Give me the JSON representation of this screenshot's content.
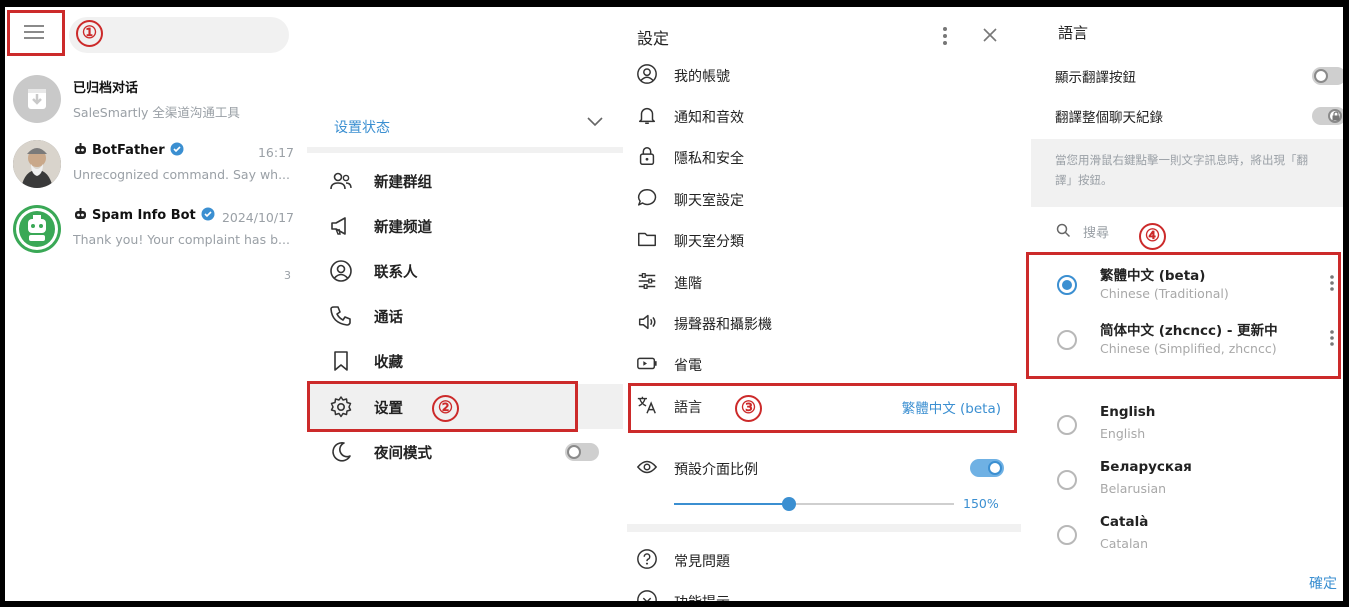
{
  "chat_list": {
    "search": {
      "placeholder": ""
    },
    "chats": [
      {
        "name": "已归档对话",
        "preview": "SaleSmartly 全渠道沟通工具",
        "time": ""
      },
      {
        "name": "BotFather",
        "preview": "Unrecognized command. Say wh...",
        "time": "16:17"
      },
      {
        "name": "Spam Info Bot",
        "preview": "Thank you! Your complaint has b...",
        "time": "2024/10/17"
      }
    ],
    "footer_mark": "3"
  },
  "main_menu": {
    "status_label": "设置状态",
    "items": [
      {
        "label": "新建群组",
        "icon": "group-icon"
      },
      {
        "label": "新建频道",
        "icon": "megaphone-icon"
      },
      {
        "label": "联系人",
        "icon": "contact-icon"
      },
      {
        "label": "通话",
        "icon": "phone-icon"
      },
      {
        "label": "收藏",
        "icon": "bookmark-icon"
      },
      {
        "label": "设置",
        "icon": "gear-icon"
      },
      {
        "label": "夜间模式",
        "icon": "moon-icon"
      }
    ],
    "night_mode": false
  },
  "settings": {
    "title": "設定",
    "items": [
      {
        "label": "我的帳號",
        "icon": "account-icon"
      },
      {
        "label": "通知和音效",
        "icon": "bell-icon"
      },
      {
        "label": "隱私和安全",
        "icon": "lock-icon"
      },
      {
        "label": "聊天室設定",
        "icon": "chat-bubble-icon"
      },
      {
        "label": "聊天室分類",
        "icon": "folder-icon"
      },
      {
        "label": "進階",
        "icon": "sliders-icon"
      },
      {
        "label": "揚聲器和攝影機",
        "icon": "speaker-icon"
      },
      {
        "label": "省電",
        "icon": "battery-icon"
      },
      {
        "label": "語言",
        "icon": "translate-icon",
        "value": "繁體中文 (beta)"
      }
    ],
    "scale_label": "預設介面比例",
    "scale_enabled": true,
    "scale_value": "150%",
    "scale_fraction": 0.41,
    "faq_label": "常見問題",
    "features_label": "功能提示"
  },
  "language": {
    "title": "語言",
    "toggles": [
      {
        "label": "顯示翻譯按鈕",
        "on": false
      },
      {
        "label": "翻譯整個聊天紀錄",
        "on": false,
        "locked": true
      }
    ],
    "hint": "當您用滑鼠右鍵點擊一則文字訊息時，將出現「翻譯」按鈕。",
    "search_placeholder": "搜尋",
    "languages": [
      {
        "name": "繁體中文 (beta)",
        "native": "Chinese (Traditional)",
        "selected": true
      },
      {
        "name": "简体中文 (zhcncc) - 更新中",
        "native": "Chinese (Simplified, zhcncc)",
        "selected": false
      },
      {
        "name": "English",
        "native": "English",
        "selected": false
      },
      {
        "name": "Беларуская",
        "native": "Belarusian",
        "selected": false
      },
      {
        "name": "Català",
        "native": "Catalan",
        "selected": false
      }
    ],
    "confirm_label": "確定"
  },
  "annotations": {
    "n1": "①",
    "n2": "②",
    "n3": "③",
    "n4": "④"
  },
  "colors": {
    "accent": "#3b8fd1",
    "highlight": "#cc2a2a"
  }
}
